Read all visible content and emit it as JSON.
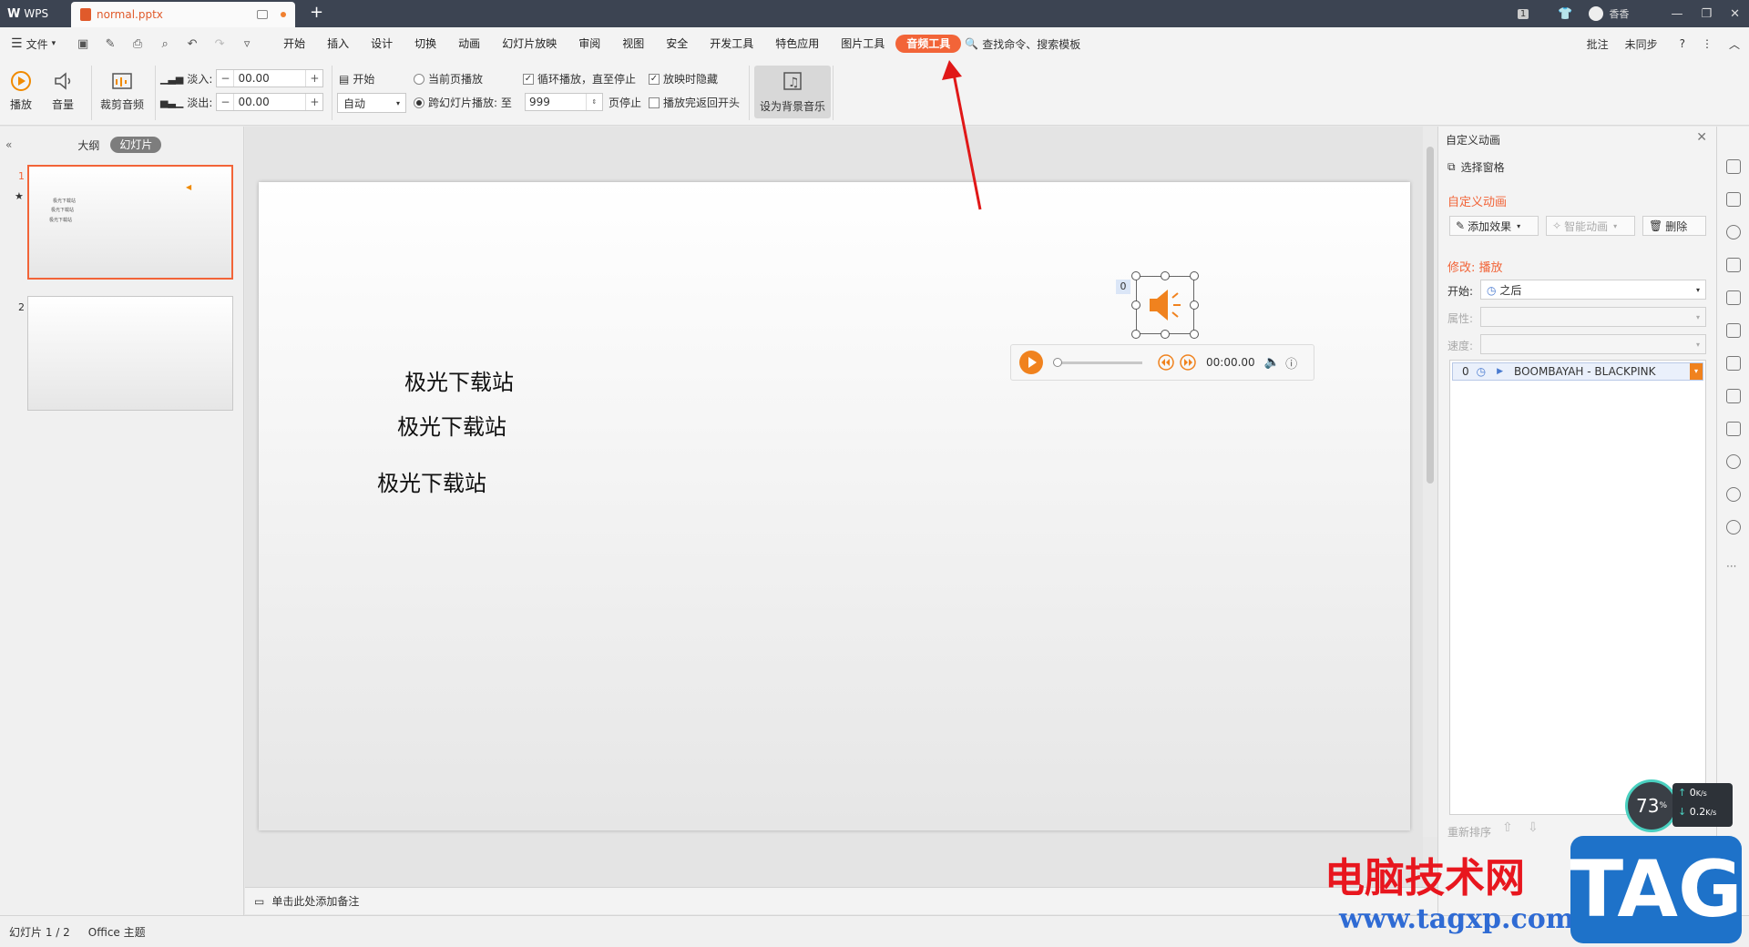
{
  "titlebar": {
    "app": "WPS",
    "tab": "normal.pptx",
    "badge": "1",
    "user": "香香"
  },
  "menubar": {
    "file": "文件",
    "tabs": [
      "开始",
      "插入",
      "设计",
      "切换",
      "动画",
      "幻灯片放映",
      "审阅",
      "视图",
      "安全",
      "开发工具",
      "特色应用",
      "图片工具"
    ],
    "active_tab": "音频工具",
    "search": "查找命令、搜索模板",
    "comment": "批注",
    "sync": "未同步",
    "help": "?"
  },
  "ribbon": {
    "play": "播放",
    "volume": "音量",
    "trim": "裁剪音频",
    "fade_in_label": "淡入:",
    "fade_in_value": "00.00",
    "fade_out_label": "淡出:",
    "fade_out_value": "00.00",
    "start_label": "开始",
    "start_value": "自动",
    "current_page": "当前页播放",
    "cross_slide": "跨幻灯片播放: 至",
    "cross_value": "999",
    "page_stop": "页停止",
    "loop": "循环播放，直至停止",
    "hide": "放映时隐藏",
    "rewind": "播放完返回开头",
    "bg_music": "设为背景音乐"
  },
  "leftpanel": {
    "outline": "大纲",
    "slides": "幻灯片",
    "slide1_num": "1",
    "slide2_num": "2",
    "thumb_texts": [
      "极光下载站",
      "极光下载站",
      "极光下载站"
    ]
  },
  "slide": {
    "texts": [
      "极光下载站",
      "极光下载站",
      "极光下载站"
    ],
    "anim_index": "0",
    "time": "00:00.00"
  },
  "notes": {
    "placeholder": "单击此处添加备注"
  },
  "rightpanel": {
    "title": "自定义动画",
    "select_pane": "选择窗格",
    "section1": "自定义动画",
    "add_effect": "添加效果",
    "smart_anim": "智能动画",
    "delete": "删除",
    "section2": "修改: 播放",
    "start_label": "开始:",
    "start_value": "之后",
    "prop_label": "属性:",
    "speed_label": "速度:",
    "item_index": "0",
    "item_name": "BOOMBAYAH - BLACKPINK",
    "reorder": "重新排序"
  },
  "status": {
    "slide_count": "幻灯片 1 / 2",
    "theme": "Office 主题"
  },
  "watermark": {
    "site": "电脑技术网",
    "url": "www.tagxp.com",
    "tag": "TAG"
  },
  "monitor": {
    "cpu": "73",
    "cpu_unit": "%",
    "up": "0",
    "up_unit": "K/s",
    "down": "0.2",
    "down_unit": "K/s"
  },
  "colors": {
    "accent": "#f26438",
    "titlebar": "#3c4452",
    "arrow": "#e01818"
  }
}
